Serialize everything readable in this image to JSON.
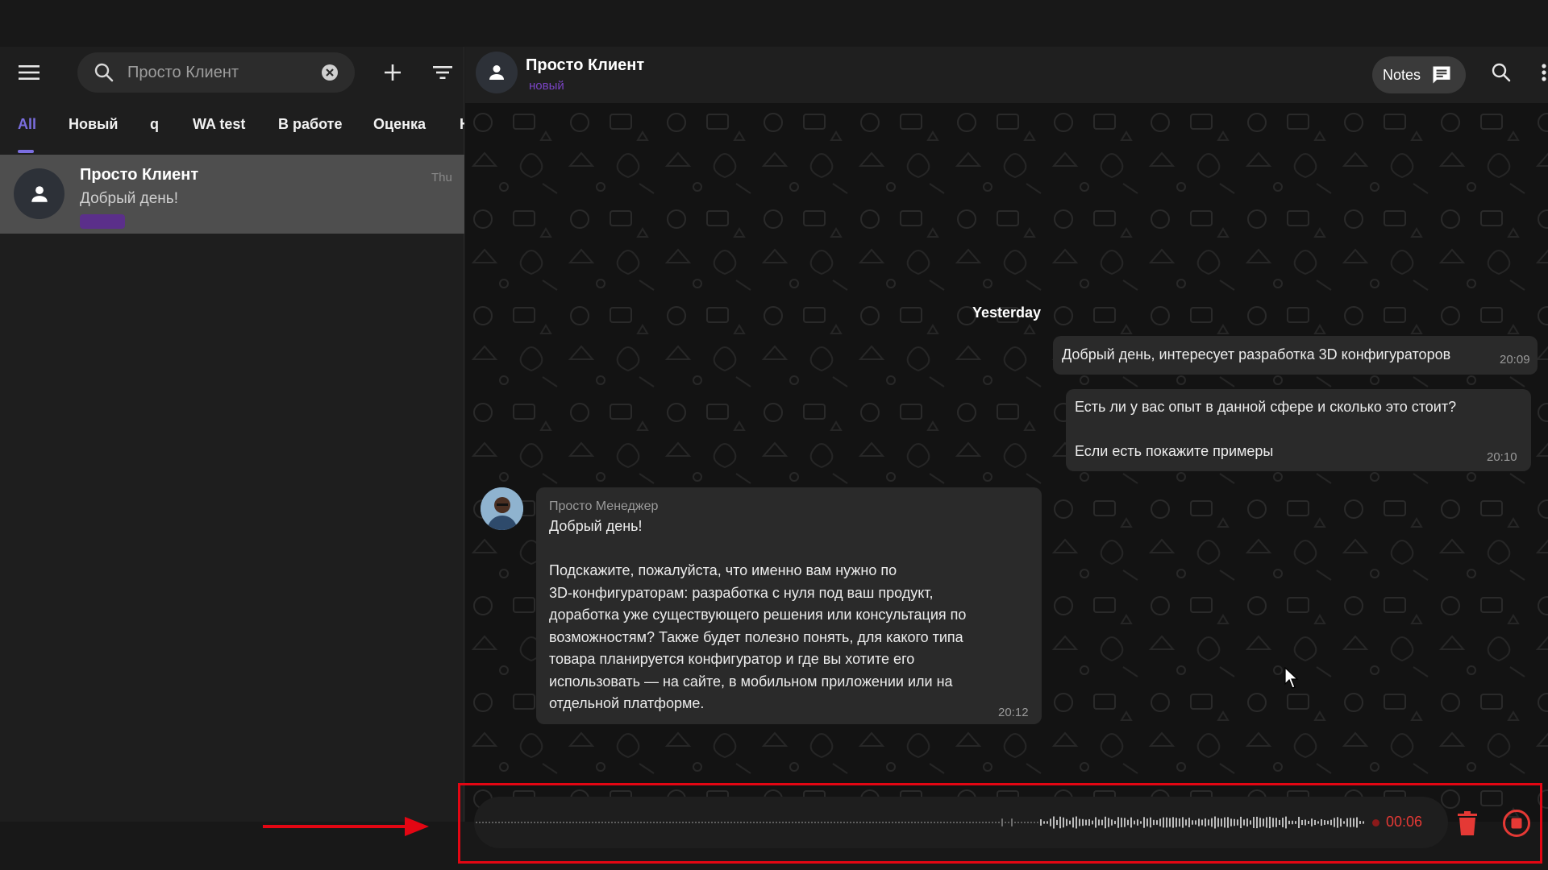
{
  "sidebar": {
    "search": {
      "value": "Просто Клиент"
    },
    "tabs": [
      "All",
      "Новый",
      "q",
      "WA test",
      "В работе",
      "Оценка",
      "Н"
    ],
    "chat": {
      "name": "Просто Клиент",
      "preview": "Добрый день!",
      "time": "Thu"
    }
  },
  "header": {
    "name": "Просто Клиент",
    "status": "новый",
    "notes_label": "Notes"
  },
  "messages": {
    "date_separator": "Yesterday",
    "m1": {
      "text": "Добрый день,  интересует разработка 3D конфигураторов",
      "time": "20:09"
    },
    "m2": {
      "line1": "Есть ли у вас опыт в данной сфере и сколько это стоит?",
      "line2": "Если есть покажите примеры",
      "time": "20:10"
    },
    "m3": {
      "sender": "Просто Менеджер",
      "greeting": "Добрый день!",
      "lines": [
        "Подскажите, пожалуйста, что именно вам нужно по",
        "3D-конфигураторам: разработка с нуля под ваш продукт,",
        "доработка уже существующего решения или консультация по",
        "возможностям? Также будет полезно понять, для какого типа",
        "товара планируется конфигуратор и где вы хотите его",
        "использовать — на сайте, в мобильном приложении или на",
        "отдельной платформе."
      ],
      "time": "20:12"
    }
  },
  "recorder": {
    "elapsed": "00:06"
  },
  "colors": {
    "accent": "#7b6ee0",
    "recording": "#e53935",
    "annotation": "#e30613",
    "status": "#7a44c4"
  },
  "icons": [
    "menu-icon",
    "search-icon",
    "clear-icon",
    "plus-icon",
    "filter-icon",
    "person-icon",
    "notes-icon",
    "more-vert-icon",
    "trash-icon",
    "stop-icon"
  ]
}
